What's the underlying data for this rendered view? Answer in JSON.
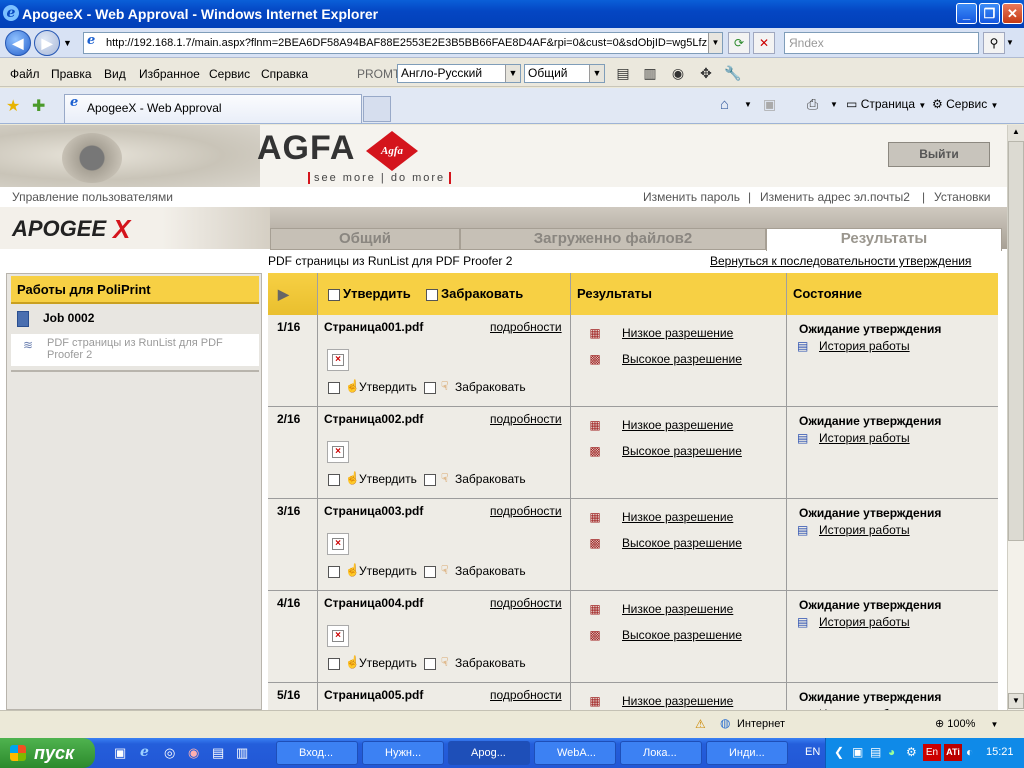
{
  "window": {
    "title": "ApogeeX - Web Approval - Windows Internet Explorer"
  },
  "addressbar": {
    "url": "http://192.168.1.7/main.aspx?flnm=2BEA6DF58A94BAF88E2553E2E3B5BB66FAE8D4AF&rpi=0&cust=0&sdObjID=wg5LfzDF",
    "search_placeholder": "Яndex"
  },
  "menu": {
    "items": [
      "Файл",
      "Правка",
      "Вид",
      "Избранное",
      "Сервис",
      "Справка"
    ],
    "promt_label": "PROMT",
    "translation_direction": "Англо-Русский",
    "translation_subject": "Общий"
  },
  "browser_tab": {
    "label": "ApogeeX - Web Approval"
  },
  "command_bar": {
    "page_label": "Страница",
    "tools_label": "Сервис"
  },
  "page": {
    "logo_text": "AGFA",
    "logo_badge": "Agfa",
    "tagline": "see more | do more",
    "logout_label": "Выйти",
    "user_management": "Управление пользователями",
    "change_password": "Изменить пароль",
    "change_email": "Изменить адрес эл.почты2",
    "settings": "Установки",
    "apogee_logo": "APOGEE",
    "apogee_x": "X",
    "tabs": [
      {
        "label": "Общий"
      },
      {
        "label": "Загруженно файлов2"
      },
      {
        "label": "Результаты"
      }
    ],
    "breadcrumb_text": "PDF страницы из RunList для PDF Proofer 2",
    "back_link": "Вернуться к последовательности утверждения",
    "left_panel": {
      "title": "Работы для PoliPrint",
      "job": "Job 0002",
      "subitem": "PDF страницы из RunList для PDF Proofer 2"
    },
    "table": {
      "header_approve": "Утвердить",
      "header_reject": "Забраковать",
      "header_results": "Результаты",
      "header_status": "Состояние",
      "details_label": "подробности",
      "approve_label": "Утвердить",
      "reject_label": "Забраковать",
      "low_res": "Низкое разрешение",
      "high_res": "Высокое разрешение",
      "history": "История работы",
      "rows": [
        {
          "num": "1/16",
          "file": "Страница001.pdf",
          "status": "Ожидание утверждения"
        },
        {
          "num": "2/16",
          "file": "Страница002.pdf",
          "status": "Ожидание утверждения"
        },
        {
          "num": "3/16",
          "file": "Страница003.pdf",
          "status": "Ожидание утверждения"
        },
        {
          "num": "4/16",
          "file": "Страница004.pdf",
          "status": "Ожидание утверждения"
        },
        {
          "num": "5/16",
          "file": "Страница005.pdf",
          "status": "Ожидание утверждения"
        }
      ]
    }
  },
  "statusbar": {
    "zone": "Интернет",
    "zoom": "100%"
  },
  "taskbar": {
    "start_label": "пуск",
    "items": [
      "Вход...",
      "Нужн...",
      "Apog...",
      "WebA...",
      "Лока...",
      "Инди..."
    ],
    "lang": "EN",
    "clock": "15:21",
    "tray_lang": "En"
  },
  "colors": {
    "header_yellow": "#f7d044",
    "titlebar_blue": "#0446c3",
    "taskbar_blue": "#245edb"
  }
}
